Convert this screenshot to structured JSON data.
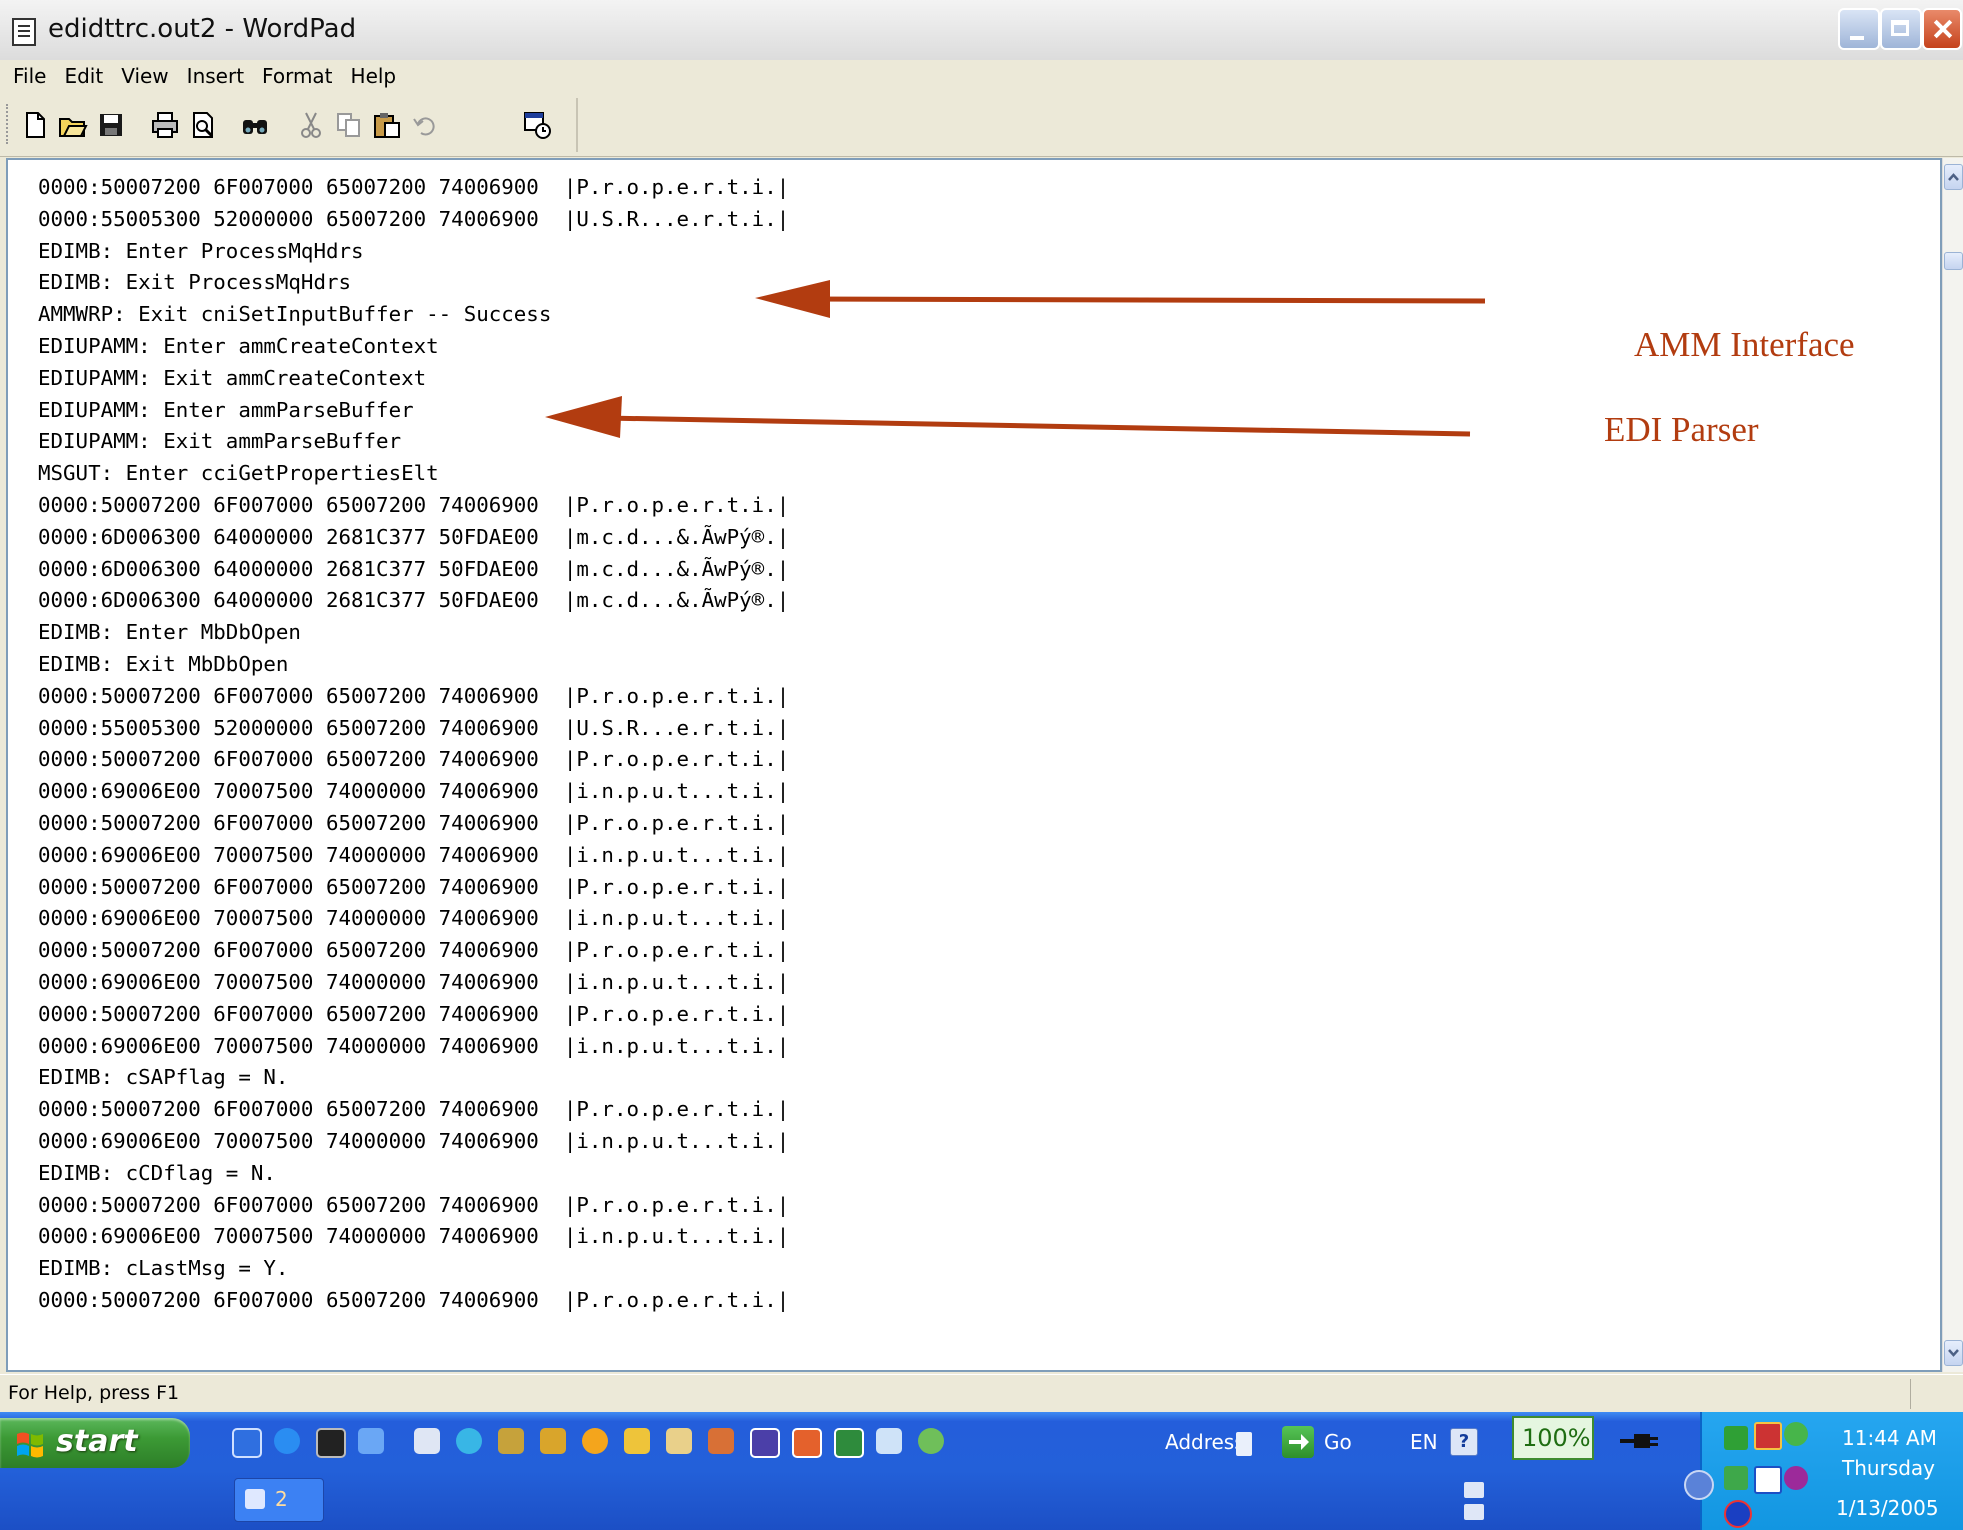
{
  "window": {
    "title": "edidttrc.out2 - WordPad"
  },
  "menu": [
    "File",
    "Edit",
    "View",
    "Insert",
    "Format",
    "Help"
  ],
  "toolbar": {
    "buttons": [
      "new-icon",
      "open-icon",
      "save-icon",
      "print-icon",
      "print-preview-icon",
      "find-icon",
      "cut-icon",
      "copy-icon",
      "paste-icon",
      "undo-icon",
      "insert-datetime-icon"
    ]
  },
  "document": {
    "lines": [
      "0000:50007200 6F007000 65007200 74006900  |P.r.o.p.e.r.t.i.|",
      "0000:55005300 52000000 65007200 74006900  |U.S.R...e.r.t.i.|",
      "EDIMB: Enter ProcessMqHdrs",
      "EDIMB: Exit ProcessMqHdrs",
      "AMMWRP: Exit cniSetInputBuffer -- Success",
      "EDIUPAMM: Enter ammCreateContext",
      "EDIUPAMM: Exit ammCreateContext",
      "EDIUPAMM: Enter ammParseBuffer",
      "EDIUPAMM: Exit ammParseBuffer",
      "MSGUT: Enter cciGetPropertiesElt",
      "0000:50007200 6F007000 65007200 74006900  |P.r.o.p.e.r.t.i.|",
      "0000:6D006300 64000000 2681C377 50FDAE00  |m.c.d...&.ÃwPý®.|",
      "0000:6D006300 64000000 2681C377 50FDAE00  |m.c.d...&.ÃwPý®.|",
      "0000:6D006300 64000000 2681C377 50FDAE00  |m.c.d...&.ÃwPý®.|",
      "EDIMB: Enter MbDbOpen",
      "EDIMB: Exit MbDbOpen",
      "0000:50007200 6F007000 65007200 74006900  |P.r.o.p.e.r.t.i.|",
      "0000:55005300 52000000 65007200 74006900  |U.S.R...e.r.t.i.|",
      "0000:50007200 6F007000 65007200 74006900  |P.r.o.p.e.r.t.i.|",
      "0000:69006E00 70007500 74000000 74006900  |i.n.p.u.t...t.i.|",
      "0000:50007200 6F007000 65007200 74006900  |P.r.o.p.e.r.t.i.|",
      "0000:69006E00 70007500 74000000 74006900  |i.n.p.u.t...t.i.|",
      "0000:50007200 6F007000 65007200 74006900  |P.r.o.p.e.r.t.i.|",
      "0000:69006E00 70007500 74000000 74006900  |i.n.p.u.t...t.i.|",
      "0000:50007200 6F007000 65007200 74006900  |P.r.o.p.e.r.t.i.|",
      "0000:69006E00 70007500 74000000 74006900  |i.n.p.u.t...t.i.|",
      "0000:50007200 6F007000 65007200 74006900  |P.r.o.p.e.r.t.i.|",
      "0000:69006E00 70007500 74000000 74006900  |i.n.p.u.t...t.i.|",
      "EDIMB: cSAPflag = N.",
      "0000:50007200 6F007000 65007200 74006900  |P.r.o.p.e.r.t.i.|",
      "0000:69006E00 70007500 74000000 74006900  |i.n.p.u.t...t.i.|",
      "EDIMB: cCDflag = N.",
      "0000:50007200 6F007000 65007200 74006900  |P.r.o.p.e.r.t.i.|",
      "0000:69006E00 70007500 74000000 74006900  |i.n.p.u.t...t.i.|",
      "EDIMB: cLastMsg = Y.",
      "0000:50007200 6F007000 65007200 74006900  |P.r.o.p.e.r.t.i.|"
    ]
  },
  "annotations": {
    "amm": "AMM Interface",
    "edi": "EDI Parser",
    "color": "#b23c10"
  },
  "statusbar": {
    "text": "For Help, press F1"
  },
  "taskbar": {
    "start_label": "start",
    "task_group_count": "2",
    "address_label": "Address",
    "go_label": "Go",
    "language": "EN",
    "help": "?",
    "battery": "100%",
    "clock": {
      "time": "11:44 AM",
      "day": "Thursday",
      "date": "1/13/2005"
    }
  }
}
